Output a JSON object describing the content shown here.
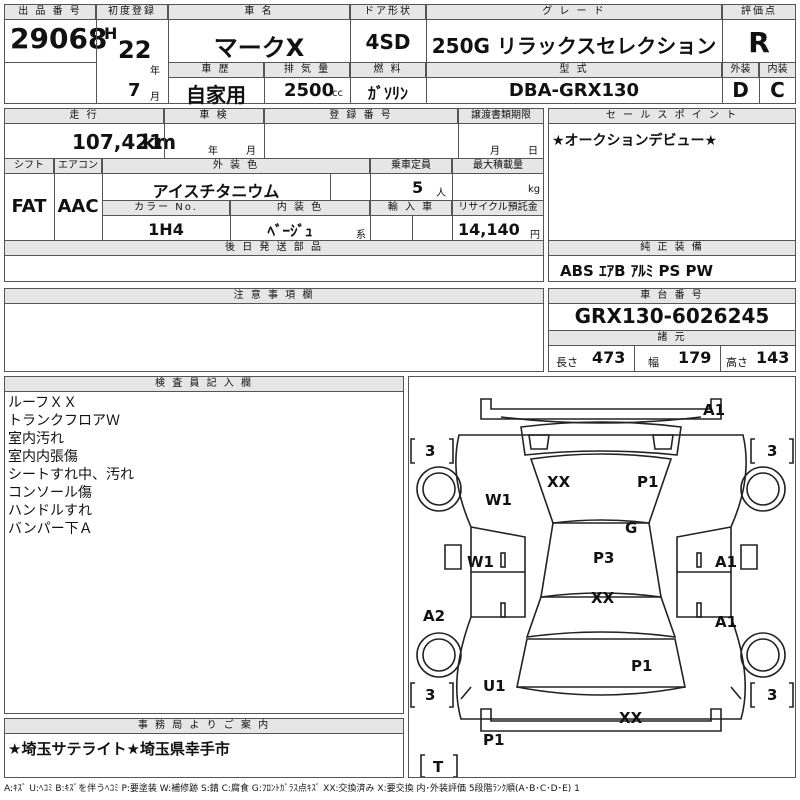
{
  "header": {
    "lot_no_label": "出 品 番 号",
    "lot_no": "29068",
    "first_reg_label": "初度登録",
    "era": "H",
    "year": "22",
    "year_unit": "年",
    "month": "7",
    "month_unit": "月",
    "car_name_label": "車 名",
    "car_name": "マークX",
    "door_label": "ドア形状",
    "door": "4SD",
    "grade_label": "グ レ ー ド",
    "grade": "250G リラックスセレクション",
    "score_label": "評価点",
    "score": "R",
    "history_label": "車 歴",
    "history": "自家用",
    "displacement_label": "排 気 量",
    "displacement": "2500",
    "displacement_unit": "cc",
    "fuel_label": "燃 料",
    "fuel": "ｶﾞｿﾘﾝ",
    "model_label": "型 式",
    "model": "DBA-GRX130",
    "exterior_label": "外装",
    "exterior": "D",
    "interior_label": "内装",
    "interior": "C"
  },
  "middle": {
    "mileage_label": "走 行",
    "mileage": "107,421",
    "mileage_unit": "km",
    "inspection_label": "車 検",
    "inspection_year_unit": "年",
    "inspection_month_unit": "月",
    "reg_no_label": "登 録 番 号",
    "transfer_label": "譲渡書類期限",
    "transfer_month_unit": "月",
    "transfer_day_unit": "日",
    "shift_label": "シフト",
    "shift": "FAT",
    "ac_label": "エアコン",
    "ac": "AAC",
    "ext_color_label": "外 装 色",
    "ext_color": "アイスチタニウム",
    "capacity_label": "乗車定員",
    "capacity": "5",
    "capacity_unit": "人",
    "max_load_label": "最大積載量",
    "max_load_unit": "kg",
    "color_no_label": "カラー No.",
    "color_no": "1H4",
    "int_color_label": "内 装 色",
    "int_color": "ﾍﾞｰｼﾞｭ",
    "int_color_unit": "系",
    "import_label": "輸 入 車",
    "recycle_label": "リサイクル預託金",
    "recycle": "14,140",
    "recycle_unit": "円",
    "later_parts_label": "後 日 発 送 部 品",
    "sales_point_label": "セ ー ル ス ポ イ ン ト",
    "sales_point": "★オークションデビュー★",
    "equipment_label": "純 正 装 備",
    "equipment": "ABS ｴｱB ｱﾙﾐ PS PW",
    "notes_label": "注 意 事 項 欄",
    "chassis_label": "車 台 番 号",
    "chassis": "GRX130-6026245",
    "dims_label": "諸 元",
    "length_label": "長さ",
    "length": "473",
    "width_label": "幅",
    "width": "179",
    "height_label": "高さ",
    "height": "143"
  },
  "inspector": {
    "label": "検 査 員 記 入 欄",
    "notes": [
      "ルーフＸＸ",
      "トランクフロアＷ",
      "室内汚れ",
      "室内内張傷",
      "シートすれ中、汚れ",
      "コンソール傷",
      "ハンドルすれ",
      "バンパー下Ａ"
    ]
  },
  "office": {
    "label": "事 務 局 よ り ご 案 内",
    "text": "★埼玉サテライト★埼玉県幸手市"
  },
  "diagram": {
    "marks": {
      "rear_bumper": "A1",
      "roof": "XX",
      "roof_right": "P1",
      "left_rear_quarter": "W1",
      "rear_glass": "G",
      "left_rear_door": "W1",
      "center": "P3",
      "right_rear_door": "A1",
      "hood_area": "XX",
      "left_front_door": "A2",
      "right_front_door": "A1",
      "front_right": "P1",
      "left_front_fender": "U1",
      "front_bumper": "XX",
      "front_left": "P1"
    },
    "tire_marks": {
      "rear_left": "3",
      "rear_right": "3",
      "front_left": "3",
      "front_right": "3",
      "spare": "T"
    }
  },
  "legend": "A:ｷｽﾞ U:ﾍｺﾐ B:ｷｽﾞを伴うﾍｺﾐ P:要塗装 W:補修跡 S:錆 C:腐食 G:ﾌﾛﾝﾄｶﾞﾗｽ点ｷｽﾞ XX:交換済み X:要交換 内･外装評価 5段階ﾗﾝｸ順(A･B･C･D･E) 1"
}
